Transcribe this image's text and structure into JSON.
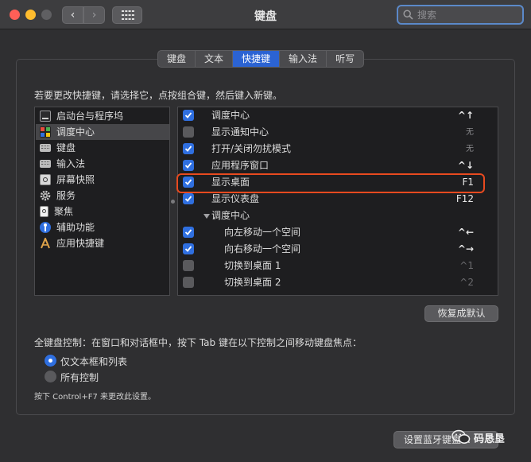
{
  "window": {
    "title": "键盘",
    "search_placeholder": "搜索",
    "nav_back": "‹",
    "nav_forward": "›"
  },
  "tabs": [
    {
      "label": "键盘",
      "active": false
    },
    {
      "label": "文本",
      "active": false
    },
    {
      "label": "快捷键",
      "active": true
    },
    {
      "label": "输入法",
      "active": false
    },
    {
      "label": "听写",
      "active": false
    }
  ],
  "instruction": "若要更改快捷键，请选择它，点按组合键，然后键入新键。",
  "categories": [
    {
      "label": "启动台与程序坞",
      "icon": "launchpad-icon"
    },
    {
      "label": "调度中心",
      "icon": "mission-control-icon",
      "selected": true
    },
    {
      "label": "键盘",
      "icon": "keyboard-icon"
    },
    {
      "label": "输入法",
      "icon": "input-method-icon"
    },
    {
      "label": "屏幕快照",
      "icon": "screenshot-icon"
    },
    {
      "label": "服务",
      "icon": "gear-icon"
    },
    {
      "label": "聚焦",
      "icon": "spotlight-icon"
    },
    {
      "label": "辅助功能",
      "icon": "accessibility-icon"
    },
    {
      "label": "应用快捷键",
      "icon": "app-shortcuts-icon"
    }
  ],
  "shortcuts": [
    {
      "label": "调度中心",
      "key": "^↑",
      "checked": true,
      "indent": 0,
      "style": "bold"
    },
    {
      "label": "显示通知中心",
      "key": "无",
      "checked": false,
      "indent": 0,
      "style": "dim"
    },
    {
      "label": "打开/关闭勿扰模式",
      "key": "无",
      "checked": true,
      "indent": 0,
      "style": "dim"
    },
    {
      "label": "应用程序窗口",
      "key": "^↓",
      "checked": true,
      "indent": 0,
      "style": "bold"
    },
    {
      "label": "显示桌面",
      "key": "F1",
      "checked": true,
      "indent": 0,
      "style": "normal"
    },
    {
      "label": "显示仪表盘",
      "key": "F12",
      "checked": true,
      "indent": 0,
      "style": "normal"
    },
    {
      "label": "调度中心",
      "key": "",
      "checked": null,
      "indent": 0,
      "group": true
    },
    {
      "label": "向左移动一个空间",
      "key": "^←",
      "checked": true,
      "indent": 1,
      "style": "bold"
    },
    {
      "label": "向右移动一个空间",
      "key": "^→",
      "checked": true,
      "indent": 1,
      "style": "bold"
    },
    {
      "label": "切换到桌面 1",
      "key": "^1",
      "checked": false,
      "indent": 1,
      "style": "gray"
    },
    {
      "label": "切换到桌面 2",
      "key": "^2",
      "checked": false,
      "indent": 1,
      "style": "gray"
    }
  ],
  "restore_defaults": "恢复成默认",
  "full_keyboard": {
    "description": "全键盘控制：在窗口和对话框中，按下 Tab 键在以下控制之间移动键盘焦点：",
    "options": [
      {
        "label": "仅文本框和列表",
        "selected": true
      },
      {
        "label": "所有控制",
        "selected": false
      }
    ],
    "hint": "按下 Control+F7 来更改此设置。"
  },
  "bluetooth_button": "设置蓝牙键盘…",
  "watermark": "码恳垦",
  "colors": {
    "accent": "#2f6fe0",
    "highlight_border": "#e84a1f"
  }
}
